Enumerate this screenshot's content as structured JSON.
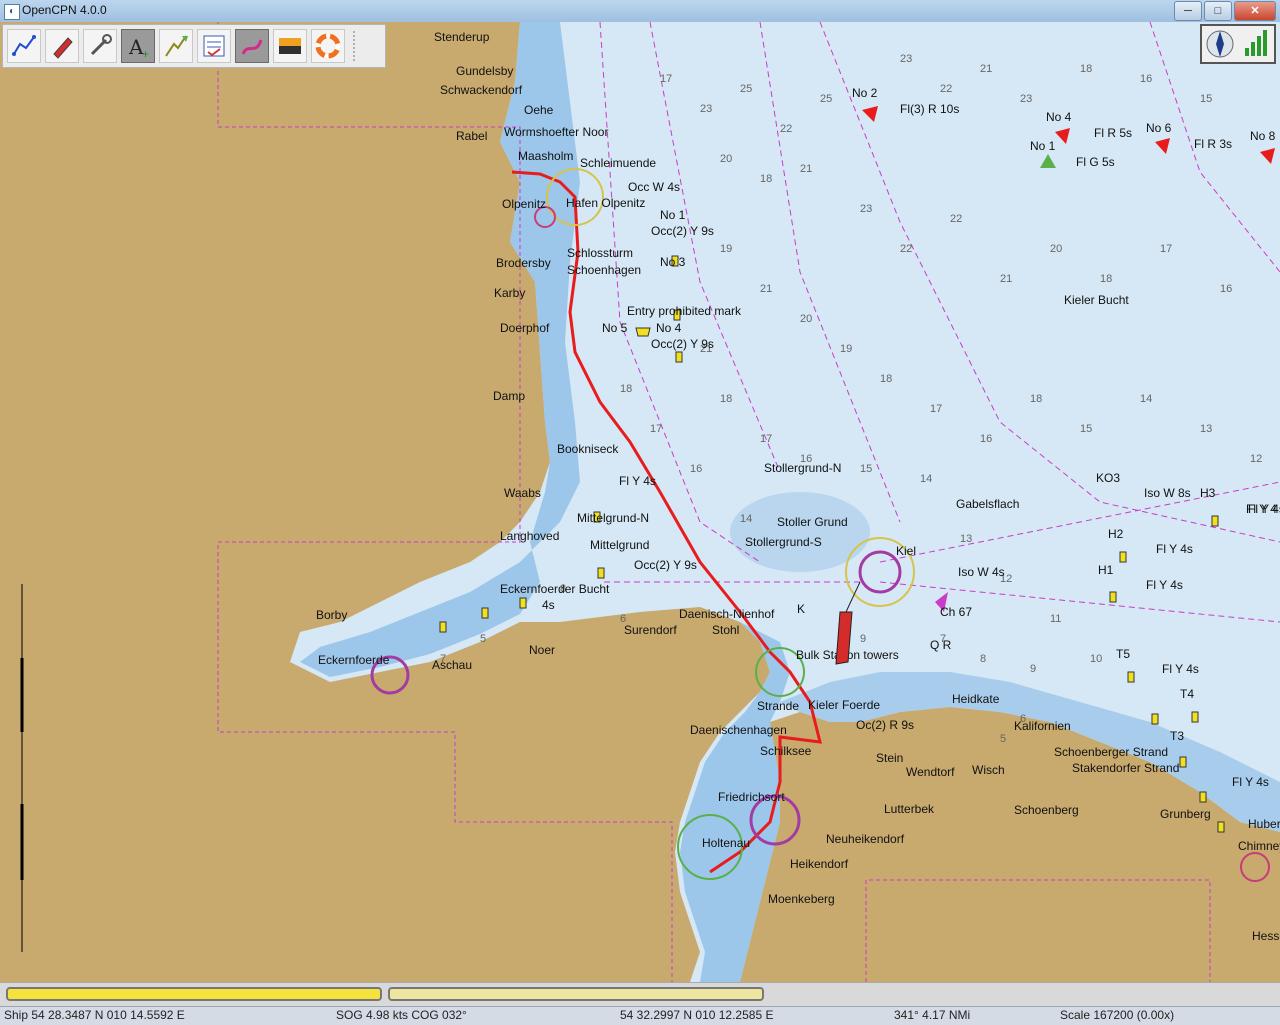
{
  "window": {
    "title": "OpenCPN 4.0.0",
    "minimize": "─",
    "maximize": "□",
    "close": "✕"
  },
  "toolbar": {
    "tools": [
      {
        "name": "route-tool",
        "icon": "route-icon"
      },
      {
        "name": "follow-ship",
        "icon": "ship-icon"
      },
      {
        "name": "settings",
        "icon": "wrench-icon"
      },
      {
        "name": "add-text",
        "icon": "text-a-icon",
        "active": true
      },
      {
        "name": "track",
        "icon": "track-icon"
      },
      {
        "name": "route-manager",
        "icon": "checklist-icon"
      },
      {
        "name": "route-draw",
        "icon": "pen-route-icon",
        "active": true
      },
      {
        "name": "color-scheme",
        "icon": "sunset-icon"
      },
      {
        "name": "mob",
        "icon": "lifebuoy-icon"
      }
    ]
  },
  "map": {
    "places": [
      {
        "t": "Stenderup"
      },
      {
        "t": "Gundelsby"
      },
      {
        "t": "Schwackendorf"
      },
      {
        "t": "Oehe"
      },
      {
        "t": "Rabel"
      },
      {
        "t": "Wormshoefter Noor"
      },
      {
        "t": "Maasholm"
      },
      {
        "t": "Schleimuende"
      },
      {
        "t": "Olpenitz"
      },
      {
        "t": "Hafen Olpenitz"
      },
      {
        "t": "Schlossturm"
      },
      {
        "t": "Schoenhagen"
      },
      {
        "t": "Brodersby"
      },
      {
        "t": "Karby"
      },
      {
        "t": "Doerphof"
      },
      {
        "t": "Damp"
      },
      {
        "t": "Bookniseck"
      },
      {
        "t": "Waabs"
      },
      {
        "t": "Langhoved"
      },
      {
        "t": "Mittelgrund-N"
      },
      {
        "t": "Mittelgrund"
      },
      {
        "t": "Eckernfoerder Bucht"
      },
      {
        "t": "Borby"
      },
      {
        "t": "Eckernfoerde"
      },
      {
        "t": "Aschau"
      },
      {
        "t": "Noer"
      },
      {
        "t": "Surendorf"
      },
      {
        "t": "Daenisch-Nienhof"
      },
      {
        "t": "Stohl"
      },
      {
        "t": "Stollergrund-N"
      },
      {
        "t": "Stoller Grund"
      },
      {
        "t": "Stollergrund-S"
      },
      {
        "t": "Gabelsflach"
      },
      {
        "t": "Kiel"
      },
      {
        "t": "Kieler Bucht"
      },
      {
        "t": "Ch 67"
      },
      {
        "t": "Q R"
      },
      {
        "t": "Bulk Station towers"
      },
      {
        "t": "Strande"
      },
      {
        "t": "Kieler Foerde"
      },
      {
        "t": "Daenischenhagen"
      },
      {
        "t": "Schilksee"
      },
      {
        "t": "Heidkate"
      },
      {
        "t": "Kalifornien"
      },
      {
        "t": "Stein"
      },
      {
        "t": "Wendtorf"
      },
      {
        "t": "Wisch"
      },
      {
        "t": "Schoenberger Strand"
      },
      {
        "t": "Stakendorfer Strand"
      },
      {
        "t": "Friedrichsort"
      },
      {
        "t": "Lutterbek"
      },
      {
        "t": "Schoenberg"
      },
      {
        "t": "Neuheikendorf"
      },
      {
        "t": "Holtenau"
      },
      {
        "t": "Heikendorf"
      },
      {
        "t": "Moenkeberg"
      },
      {
        "t": "Grunberg"
      },
      {
        "t": "Hubertsberg"
      },
      {
        "t": "Chimney"
      },
      {
        "t": "Hessenstein"
      },
      {
        "t": "Entry prohibited mark"
      },
      {
        "t": "K"
      }
    ],
    "lights": [
      {
        "t": "No 2"
      },
      {
        "t": "Fl(3) R 10s"
      },
      {
        "t": "No 4"
      },
      {
        "t": "No 1"
      },
      {
        "t": "Fl R 5s"
      },
      {
        "t": "No 6"
      },
      {
        "t": "Fl R 3s"
      },
      {
        "t": "No 8"
      },
      {
        "t": "Fl G 5s"
      },
      {
        "t": "Occ W 4s"
      },
      {
        "t": "No 1"
      },
      {
        "t": "Occ(2) Y 9s"
      },
      {
        "t": "No 3"
      },
      {
        "t": "No 5"
      },
      {
        "t": "No 4"
      },
      {
        "t": "Occ(2) Y 9s"
      },
      {
        "t": "Fl Y 4s"
      },
      {
        "t": "Occ(2) Y 9s"
      },
      {
        "t": "4s"
      },
      {
        "t": "Iso W 4s"
      },
      {
        "t": "KO3"
      },
      {
        "t": "Iso W 8s"
      },
      {
        "t": "H3"
      },
      {
        "t": "Fl Y 4s"
      },
      {
        "t": "H2"
      },
      {
        "t": "Fl Y 4s"
      },
      {
        "t": "H1"
      },
      {
        "t": "Fl Y 4s"
      },
      {
        "t": "T5"
      },
      {
        "t": "Fl Y 4s"
      },
      {
        "t": "T4"
      },
      {
        "t": "T3"
      },
      {
        "t": "Fl Y 4s"
      },
      {
        "t": "Oc(2) R 9s"
      },
      {
        "t": "Fl Y 4"
      }
    ],
    "depths": [
      "23",
      "25",
      "22",
      "20",
      "18",
      "21",
      "17",
      "19",
      "16",
      "15",
      "14",
      "13",
      "12",
      "11",
      "10",
      "9",
      "8",
      "7",
      "6",
      "5"
    ]
  },
  "piano": {
    "key1_color": "#f5e23a",
    "key2_color": "#ece6a0"
  },
  "status": {
    "ship": "Ship 54 28.3487 N   010 14.5592 E",
    "sog": "SOG 4.98 kts   COG 032°",
    "cursor": "54 32.2997 N   010 12.2585 E",
    "bearing": "341°   4.17 NMi",
    "scale": "Scale 167200 (0.00x)"
  },
  "colors": {
    "land": "#c8a96e",
    "shallow": "#9dc7ea",
    "deep": "#d6e8f5",
    "route": "#e81c1c",
    "boundary": "#c93cc9"
  }
}
